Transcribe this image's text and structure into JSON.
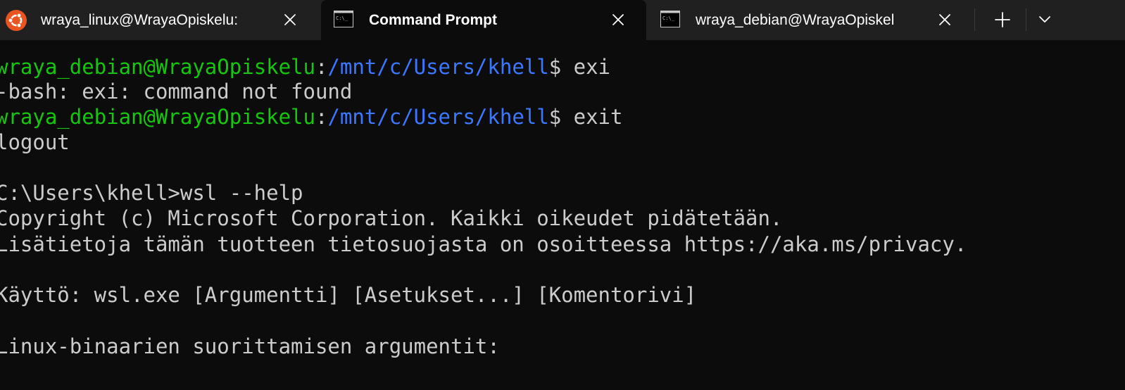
{
  "tabs": [
    {
      "title": "wraya_linux@WrayaOpiskelu:",
      "icon": "ubuntu-icon",
      "active": false
    },
    {
      "title": "Command Prompt",
      "icon": "cmd-icon",
      "active": true
    },
    {
      "title": "wraya_debian@WrayaOpiskel",
      "icon": "cmd-icon",
      "active": false
    }
  ],
  "controls": {
    "new_tab": "+",
    "dropdown": "chevron-down"
  },
  "colors": {
    "background": "#0c0c0c",
    "titlebar": "#202020",
    "text": "#cccccc",
    "user_host": "#16c60c",
    "path": "#3b78ff",
    "ubuntu_orange": "#e95420"
  },
  "terminal": {
    "line1": {
      "user": "wraya_debian@WrayaOpiskelu",
      "sep": ":",
      "path": "/mnt/c/Users/khell",
      "cmd": "$ exi"
    },
    "line2": "-bash: exi: command not found",
    "line3": {
      "user": "wraya_debian@WrayaOpiskelu",
      "sep": ":",
      "path": "/mnt/c/Users/khell",
      "cmd": "$ exit"
    },
    "line4": "logout",
    "line6": "C:\\Users\\khell>wsl --help",
    "line7": "Copyright (c) Microsoft Corporation. Kaikki oikeudet pidätetään.",
    "line8": "Lisätietoja tämän tuotteen tietosuojasta on osoitteessa https://aka.ms/privacy.",
    "line10": "Käyttö: wsl.exe [Argumentti] [Asetukset...] [Komentorivi]",
    "line12": "Linux-binaarien suorittamisen argumentit:"
  }
}
